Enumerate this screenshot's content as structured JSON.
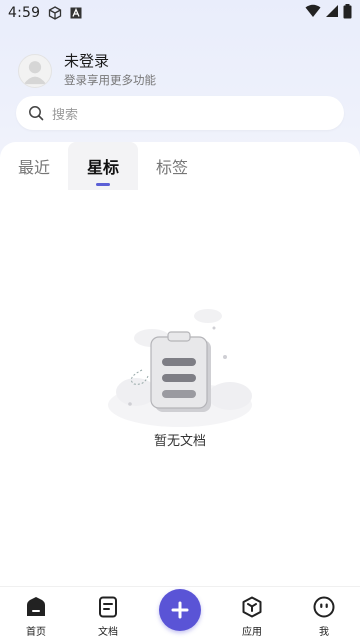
{
  "status_bar": {
    "time": "4:59",
    "icons": [
      "box-icon",
      "a-icon"
    ],
    "right_icons": [
      "wifi-icon",
      "signal-icon",
      "battery-icon"
    ]
  },
  "profile": {
    "name": "未登录",
    "subtitle": "登录享用更多功能"
  },
  "search": {
    "placeholder": "搜索"
  },
  "tabs": [
    {
      "label": "最近",
      "active": false
    },
    {
      "label": "星标",
      "active": true
    },
    {
      "label": "标签",
      "active": false
    }
  ],
  "empty_state": {
    "text": "暂无文档",
    "icon": "empty-document-illustration"
  },
  "bottom_nav": [
    {
      "label": "首页",
      "icon": "home-icon",
      "active": true
    },
    {
      "label": "文档",
      "icon": "document-icon",
      "active": false
    },
    {
      "label": "",
      "icon": "plus-icon",
      "active": false
    },
    {
      "label": "应用",
      "icon": "apps-cube-icon",
      "active": false
    },
    {
      "label": "我",
      "icon": "smiley-icon",
      "active": false
    }
  ],
  "colors": {
    "accent": "#5a54d6",
    "header_bg": "#e9edfb"
  }
}
